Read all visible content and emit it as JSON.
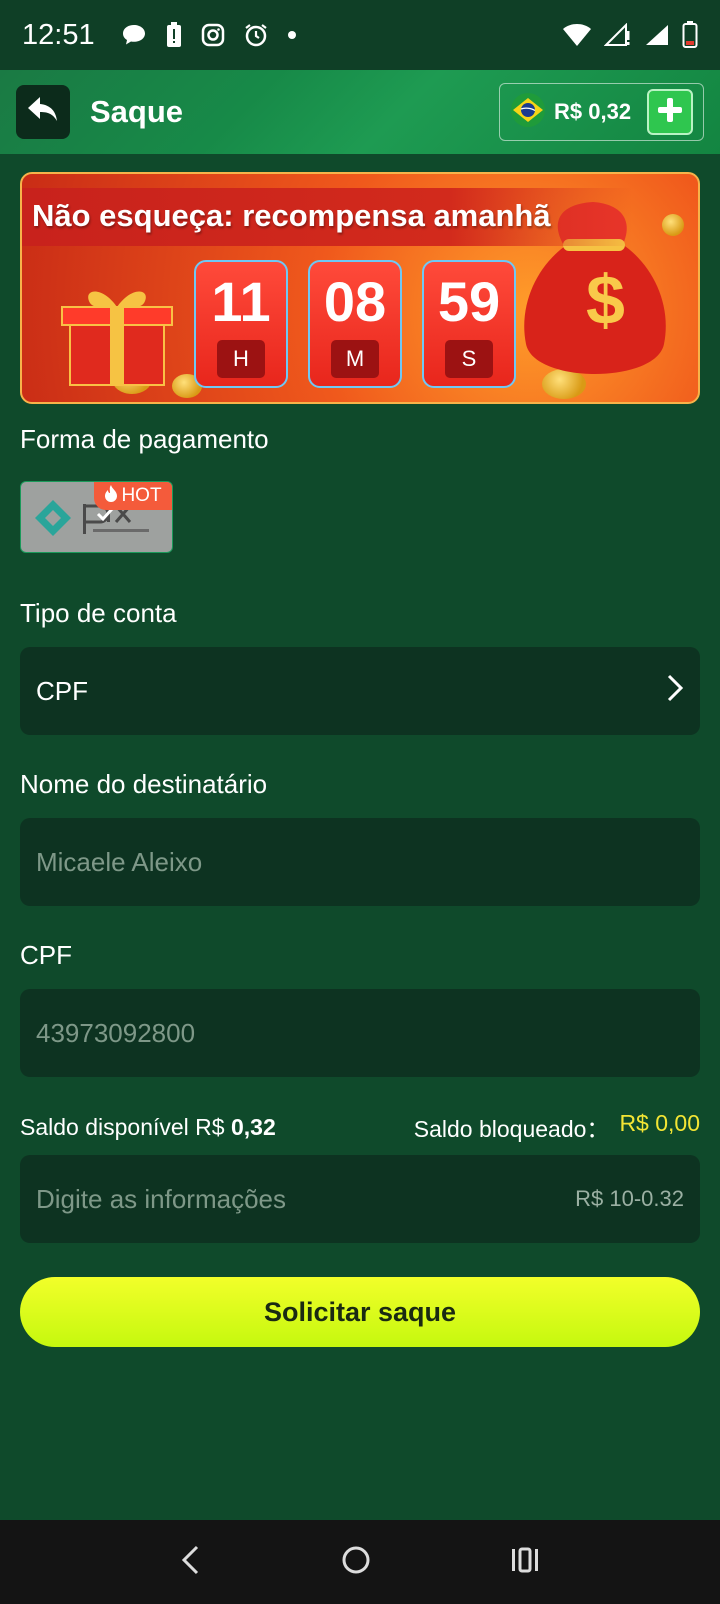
{
  "status_bar": {
    "time": "12:51"
  },
  "header": {
    "title": "Saque",
    "balance": "R$ 0,32"
  },
  "banner": {
    "heading": "Não esqueça: recompensa amanhã",
    "timer": [
      {
        "value": "11",
        "unit": "H"
      },
      {
        "value": "08",
        "unit": "M"
      },
      {
        "value": "59",
        "unit": "S"
      }
    ]
  },
  "payment": {
    "label": "Forma de pagamento",
    "method": "pix",
    "badge": "HOT"
  },
  "account_type": {
    "label": "Tipo de conta",
    "value": "CPF"
  },
  "recipient": {
    "label": "Nome do destinatário",
    "placeholder": "Micaele Aleixo"
  },
  "cpf": {
    "label": "CPF",
    "placeholder": "43973092800"
  },
  "balances": {
    "available_label": "Saldo disponível R$",
    "available_value": "0,32",
    "blocked_label": "Saldo bloqueado：",
    "blocked_value": "R$ 0,00"
  },
  "amount": {
    "placeholder": "Digite as informações",
    "range_hint": "R$ 10-0.32"
  },
  "submit_label": "Solicitar saque",
  "colors": {
    "background": "#0f4a2b",
    "accent_button": "#e6ff1f",
    "highlight_value": "#f3e534"
  }
}
